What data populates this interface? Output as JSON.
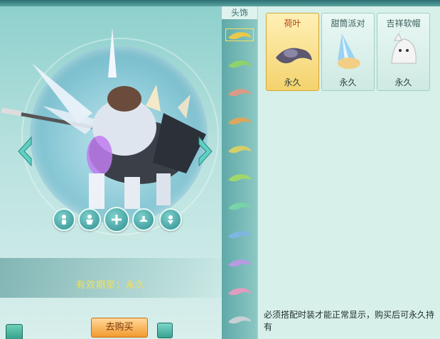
{
  "category": {
    "header": "头饰"
  },
  "items": [
    {
      "name": "荷叶",
      "duration": "永久",
      "selected": true
    },
    {
      "name": "甜筒派对",
      "duration": "永久",
      "selected": false
    },
    {
      "name": "吉祥软帽",
      "duration": "永久",
      "selected": false
    }
  ],
  "preview": {
    "validity": "有效期至：永久",
    "buy_label": "去购买"
  },
  "notice": "必须搭配时装才能正常显示，购买后可永久持有",
  "category_swatches": [
    "#e7c94c",
    "#8fd26b",
    "#d99a86",
    "#d9a75f",
    "#d6cf68",
    "#9fd86a",
    "#79d3a8",
    "#7fb6e0",
    "#b69ae2",
    "#e09cc0",
    "#c7d0d4"
  ]
}
